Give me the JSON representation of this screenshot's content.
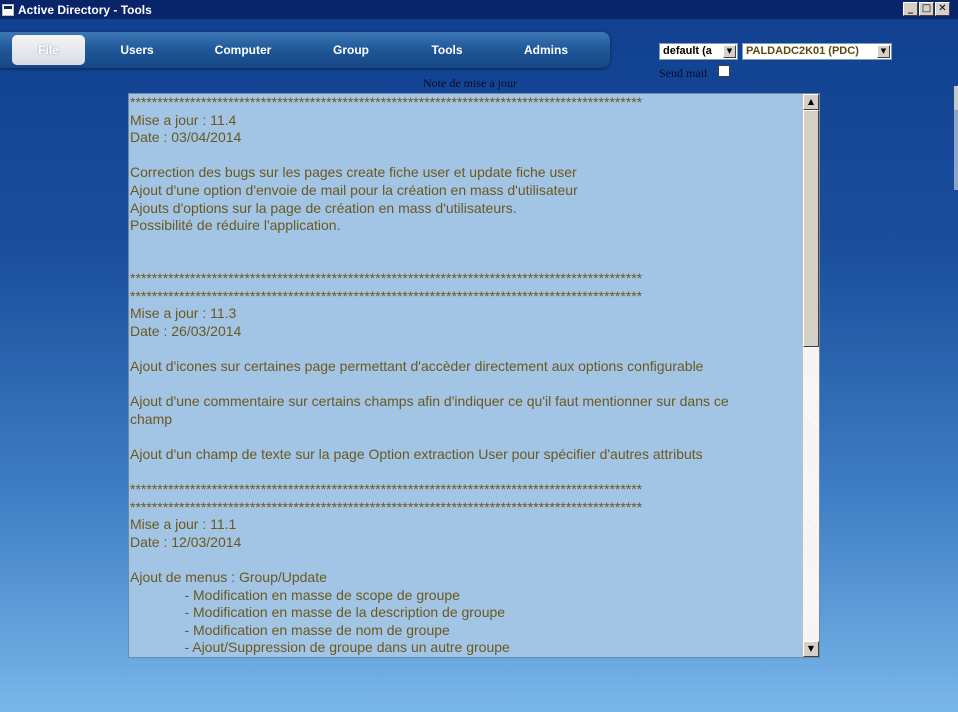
{
  "window": {
    "title": "Active Directory - Tools",
    "controls": {
      "minimize": "_",
      "maximize": "□",
      "close": "✕"
    }
  },
  "menu": {
    "items": [
      {
        "label": "File",
        "active": true
      },
      {
        "label": "Users"
      },
      {
        "label": "Computer"
      },
      {
        "label": "Group"
      },
      {
        "label": "Tools"
      },
      {
        "label": "Admins"
      }
    ]
  },
  "selectors": {
    "profile": {
      "value": "default (a",
      "icon": "chevron-down-icon"
    },
    "domain_controller": {
      "value": "PALDADC2K01 (PDC)",
      "icon": "chevron-down-icon"
    }
  },
  "send_mail": {
    "label": "Send mail",
    "checked": false
  },
  "notes": {
    "title": "Note de mise a jour",
    "text": "**********************************************************************************************\nMise a jour : 11.4\nDate : 03/04/2014\n\nCorrection des bugs sur les pages create fiche user et update fiche user\nAjout d'une option d'envoie de mail pour la création en mass d'utilisateur\nAjouts d'options sur la page de création en mass d'utilisateurs.\nPossibilité de réduire l'application.\n\n\n**********************************************************************************************\n**********************************************************************************************\nMise a jour : 11.3\nDate : 26/03/2014\n\nAjout d'icones sur certaines page permettant d'accèder directement aux options configurable\n\nAjout d'une commentaire sur certains champs afin d'indiquer ce qu'il faut mentionner sur dans ce\nchamp\n\nAjout d'un champ de texte sur la page Option extraction User pour spécifier d'autres attributs\n\n**********************************************************************************************\n**********************************************************************************************\nMise a jour : 11.1\nDate : 12/03/2014\n\nAjout de menus : Group/Update\n              - Modification en masse de scope de groupe\n              - Modification en masse de la description de groupe\n              - Modification en masse de nom de groupe\n              - Ajout/Suppression de groupe dans un autre groupe"
  },
  "colors": {
    "titlebar": "#0a246a",
    "textarea_bg": "#a3c5e5",
    "text": "#6b5820"
  }
}
